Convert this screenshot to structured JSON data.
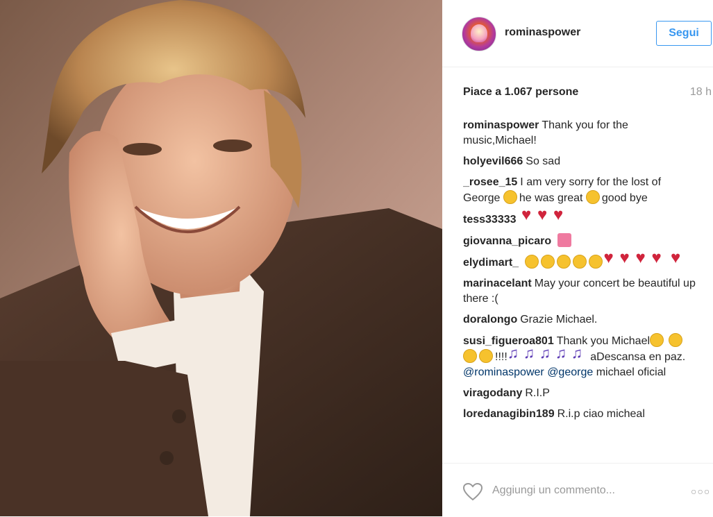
{
  "post": {
    "username": "rominaspower",
    "follow_label": "Segui",
    "likes_text": "Piace a 1.067 persone",
    "time": "18 h"
  },
  "comments": [
    {
      "user": "rominaspower",
      "text": "Thank you for the music,Michael!"
    },
    {
      "user": "holyevil666",
      "text": "So sad"
    },
    {
      "user": "_rosee_15",
      "text_a": "I am very sorry for the lost of George",
      "text_b": "he was great",
      "text_c": "good bye"
    },
    {
      "user": "tess33333",
      "text": ""
    },
    {
      "user": "giovanna_picaro",
      "text": ""
    },
    {
      "user": "elydimart_",
      "text": ""
    },
    {
      "user": "marinacelant",
      "text": "May your concert be beautiful up there :("
    },
    {
      "user": "doralongo",
      "text": "Grazie Michael."
    },
    {
      "user": "susi_figueroa801",
      "text_a": "Thank you Michael",
      "text_b": "!!!!",
      "text_c": "aDescansa en paz.",
      "mention_a": "@rominaspower",
      "mention_b": "@george",
      "text_d": "michael oficial"
    },
    {
      "user": "viragodany",
      "text": "R.I.P"
    },
    {
      "user": "loredanagibin189",
      "text": "R.i.p ciao micheal"
    }
  ],
  "footer": {
    "comment_placeholder": "Aggiungi un commento...",
    "more_label": "○○○"
  }
}
